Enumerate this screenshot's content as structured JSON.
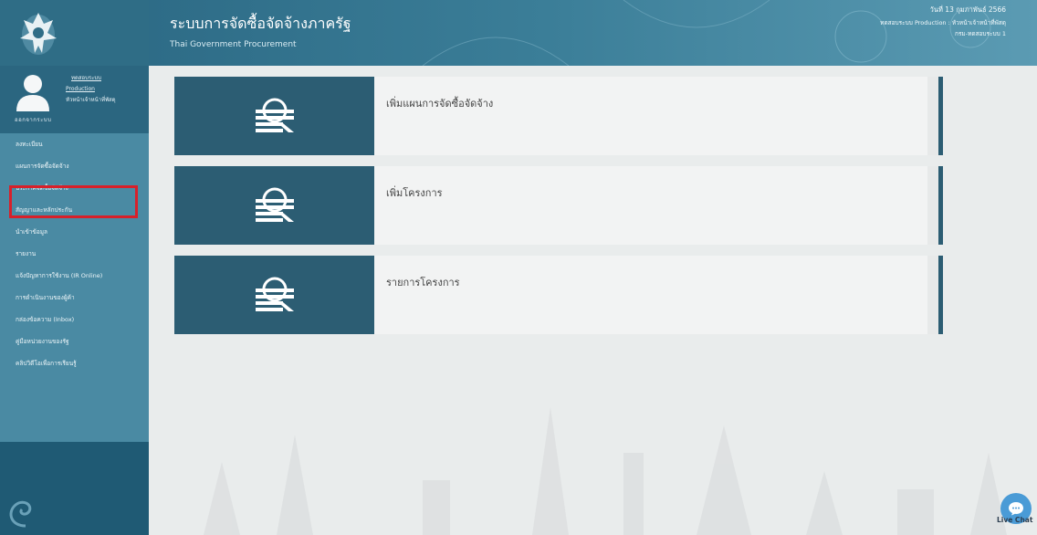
{
  "header": {
    "title": "ระบบการจัดซื้อจัดจ้างภาครัฐ",
    "subtitle": "Thai Government Procurement",
    "date": "วันที่ 13 กุมภาพันธ์ 2566",
    "user_line": "ทดสอบระบบ Production : หัวหน้าเจ้าหน้าที่พัสดุ",
    "dept_line": "กรม-ทดสอบระบบ 1"
  },
  "user": {
    "line1": "ทดสอบระบบ",
    "line2": "Production",
    "line3": "หัวหน้าเจ้าหน้าที่พัสดุ",
    "role": "ออกจากระบบ"
  },
  "menu": [
    {
      "label": "ลงทะเบียน"
    },
    {
      "label": "แผนการจัดซื้อจัดจ้าง"
    },
    {
      "label": "ประกาศจัดซื้อจัดจ้าง"
    },
    {
      "label": "สัญญาและหลักประกัน"
    },
    {
      "label": "นำเข้าข้อมูล"
    },
    {
      "label": "รายงาน"
    },
    {
      "label": "แจ้งปัญหาการใช้งาน (IR Online)"
    },
    {
      "label": "การดำเนินงานของผู้ค้า"
    },
    {
      "label": "กล่องข้อความ (Inbox)"
    },
    {
      "label": "คู่มือหน่วยงานของรัฐ"
    },
    {
      "label": "คลิปวิดีโอเพื่อการเรียนรู้"
    }
  ],
  "cards": [
    {
      "label": "เพิ่มแผนการจัดซื้อจัดจ้าง"
    },
    {
      "label": "เพิ่มโครงการ"
    },
    {
      "label": "รายการโครงการ"
    }
  ],
  "live_chat": {
    "label": "Live Chat"
  },
  "icons": {
    "home": "home-icon",
    "menu": "menu-icon",
    "search": "search-icon",
    "card": "document-search-icon",
    "chat": "chat-icon"
  },
  "colors": {
    "sidebar": "#4a8aa3",
    "header": "#2e6c87",
    "card_icon_bg": "#2c5d73",
    "highlight": "#d8202a",
    "chat": "#4a9bd6"
  }
}
